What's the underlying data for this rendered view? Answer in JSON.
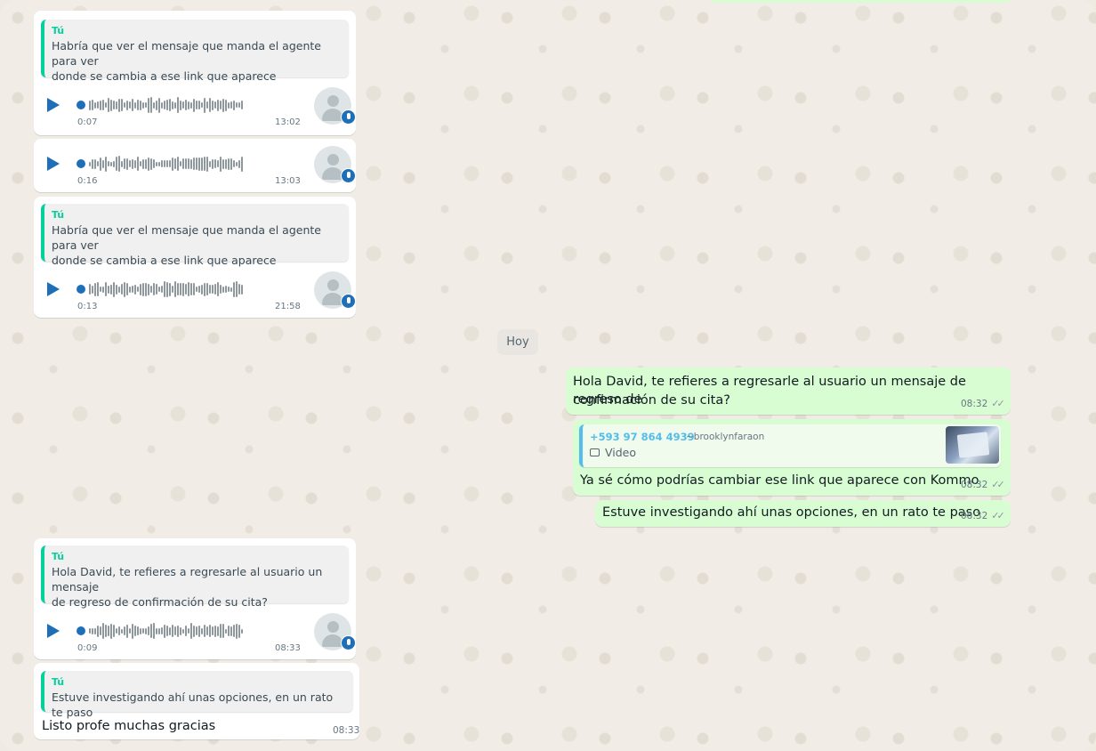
{
  "day_separator": "Hoy",
  "incoming": {
    "block1": {
      "quote_author": "Tú",
      "quote_text_line1": "Habría que ver el mensaje que manda el agente para ver",
      "quote_text_line2": "donde se cambia a ese link que aparece",
      "audio": {
        "duration": "0:07",
        "time": "13:02"
      }
    },
    "block2": {
      "audio": {
        "duration": "0:16",
        "time": "13:03"
      }
    },
    "block3": {
      "quote_author": "Tú",
      "quote_text_line1": "Habría que ver el mensaje que manda el agente para ver",
      "quote_text_line2": "donde se cambia a ese link que aparece",
      "audio": {
        "duration": "0:13",
        "time": "21:58"
      }
    },
    "block4": {
      "quote_author": "Tú",
      "quote_text_line1": "Hola David, te refieres a regresarle al usuario un mensaje",
      "quote_text_line2": "de regreso de confirmación de su cita?",
      "audio": {
        "duration": "0:09",
        "time": "08:33"
      }
    },
    "block5": {
      "quote_author": "Tú",
      "quote_text": "Estuve investigando ahí unas opciones, en un rato te paso",
      "text": "Listo profe muchas gracias",
      "time": "08:33"
    }
  },
  "outgoing": {
    "msg1": {
      "line1": "Hola David, te refieres a regresarle al usuario un mensaje de regreso de",
      "line2": "confirmación de su cita?",
      "time": "08:32",
      "ticks": "✓✓"
    },
    "msg2": {
      "quote_phone": "+593 97 864 4939",
      "quote_user": "~brooklynfaraon",
      "quote_media": "Video",
      "text": "Ya sé cómo podrías cambiar ese link que aparece con Kommo",
      "time": "08:32",
      "ticks": "✓✓"
    },
    "msg3": {
      "text": "Estuve investigando ahí unas opciones, en un rato te paso",
      "time": "08:32",
      "ticks": "✓✓"
    }
  },
  "colors": {
    "incoming_bubble": "#ffffff",
    "outgoing_bubble": "#d9fdd3",
    "quote_accent": "#06cf9c",
    "audio_accent": "#1f6fb8",
    "chat_background": "#efeae2"
  },
  "icons": [
    "play-icon",
    "microphone-icon",
    "avatar-placeholder-icon",
    "double-check-icon",
    "video-icon"
  ]
}
